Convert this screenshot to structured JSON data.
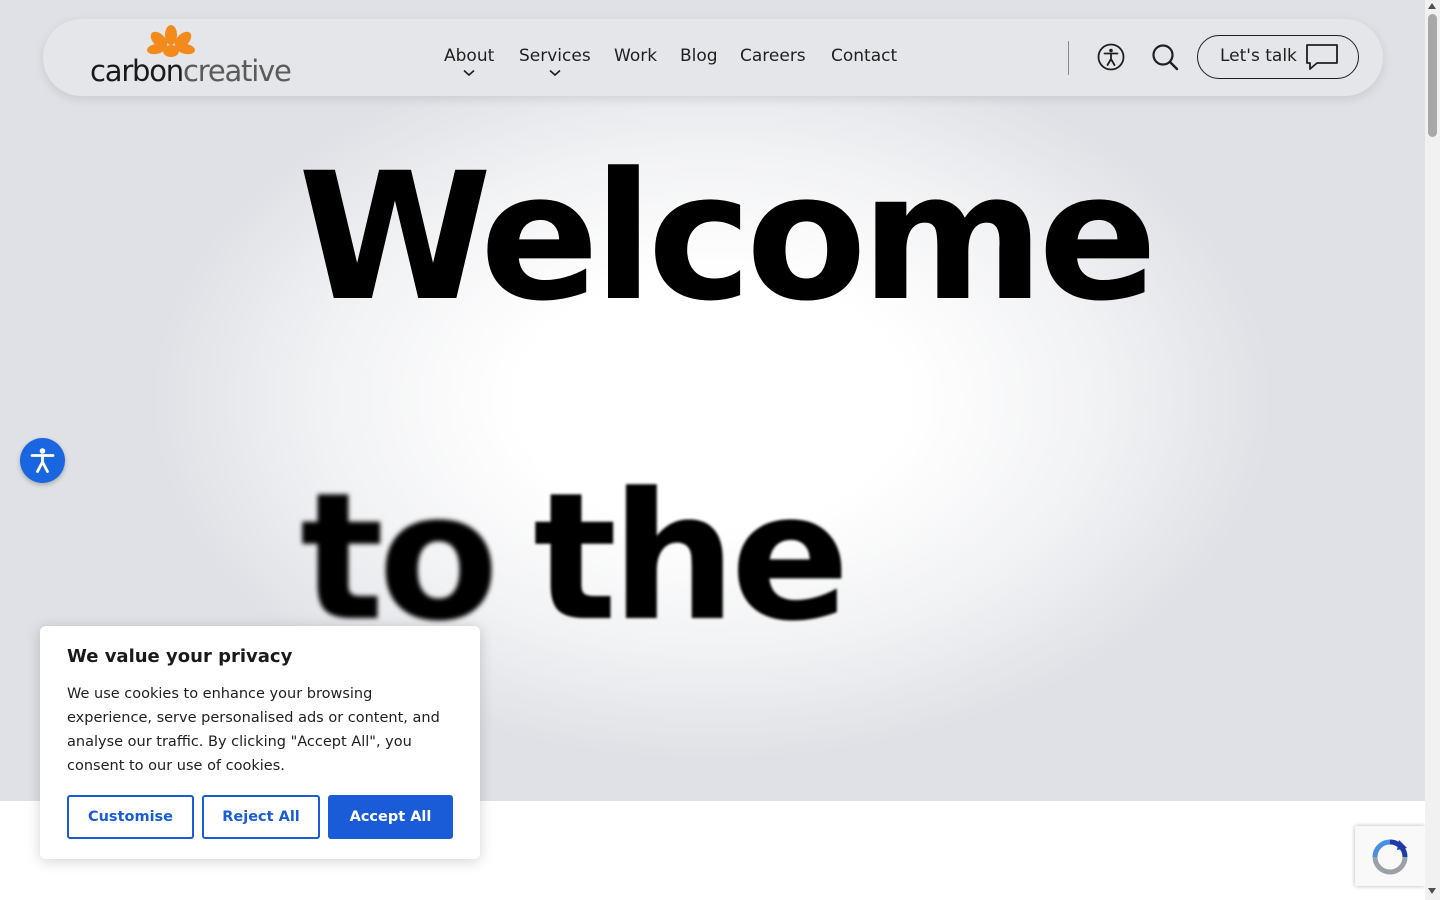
{
  "brand": {
    "logo_part1": "carbon",
    "logo_part2": "creative",
    "flower_color": "#f28a1c"
  },
  "nav": {
    "items": [
      {
        "label": "About",
        "has_dropdown": true
      },
      {
        "label": "Services",
        "has_dropdown": true
      },
      {
        "label": "Work",
        "has_dropdown": false
      },
      {
        "label": "Blog",
        "has_dropdown": false
      },
      {
        "label": "Careers",
        "has_dropdown": false
      },
      {
        "label": "Contact",
        "has_dropdown": false
      }
    ],
    "accessibility_icon": "accessibility-icon",
    "search_icon": "search-icon",
    "cta_label": "Let's talk",
    "cta_icon": "speech-bubble-icon"
  },
  "hero": {
    "line1": "Welcome",
    "line2_word1": "to",
    "line2_word2": "the"
  },
  "accessibility_widget": {
    "icon": "accessibility-person-icon",
    "color": "#1a66e0"
  },
  "cookie_banner": {
    "title": "We value your privacy",
    "body": "We use cookies to enhance your browsing experience, serve personalised ads or content, and analyse our traffic. By clicking \"Accept All\", you consent to our use of cookies.",
    "customise_label": "Customise",
    "reject_label": "Reject All",
    "accept_label": "Accept All",
    "accent_color": "#1a5cd8"
  },
  "recaptcha": {
    "icon": "recaptcha-icon"
  }
}
